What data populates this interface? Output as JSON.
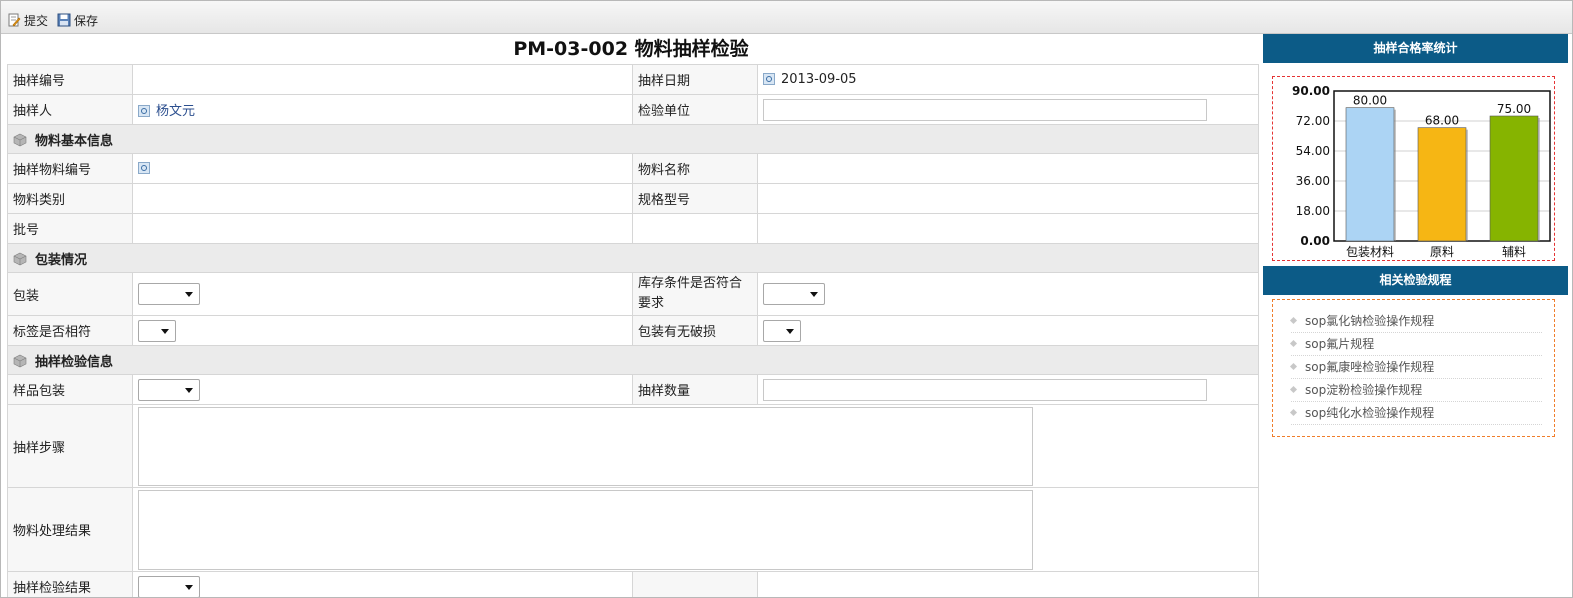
{
  "toolbar": {
    "submit_label": "提交",
    "save_label": "保存"
  },
  "form": {
    "title": "PM-03-002 物料抽样检验",
    "sampling_no_label": "抽样编号",
    "sampling_date_label": "抽样日期",
    "sampling_date_value": "2013-09-05",
    "sampler_label": "抽样人",
    "sampler_value": "杨文元",
    "inspection_unit_label": "检验单位",
    "section_material": "物料基本信息",
    "material_no_label": "抽样物料编号",
    "material_name_label": "物料名称",
    "material_category_label": "物料类别",
    "spec_model_label": "规格型号",
    "batch_no_label": "批号",
    "section_packaging": "包装情况",
    "packaging_label": "包装",
    "storage_condition_label": "库存条件是否符合要求",
    "label_match_label": "标签是否相符",
    "package_damage_label": "包装有无破损",
    "section_sampling": "抽样检验信息",
    "sample_packaging_label": "样品包装",
    "sample_quantity_label": "抽样数量",
    "sampling_steps_label": "抽样步骤",
    "material_handling_label": "物料处理结果",
    "sampling_result_label": "抽样检验结果"
  },
  "sidebar": {
    "chart_title": "抽样合格率统计",
    "rules_title": "相关检验规程",
    "rules": [
      "sop氯化钠检验操作规程",
      "sop氟片规程",
      "sop氟康唑检验操作规程",
      "sop淀粉检验操作规程",
      "sop纯化水检验操作规程"
    ]
  },
  "chart_data": {
    "type": "bar",
    "categories": [
      "包装材料",
      "原料",
      "辅料"
    ],
    "values": [
      80.0,
      68.0,
      75.0
    ],
    "data_labels": [
      "80.00",
      "68.00",
      "75.00"
    ],
    "colors": [
      "#acd4f4",
      "#f6b614",
      "#86b400"
    ],
    "ylim": [
      0,
      90
    ],
    "yticks": [
      "0.00",
      "18.00",
      "36.00",
      "54.00",
      "72.00",
      "90.00"
    ],
    "grid": true
  }
}
